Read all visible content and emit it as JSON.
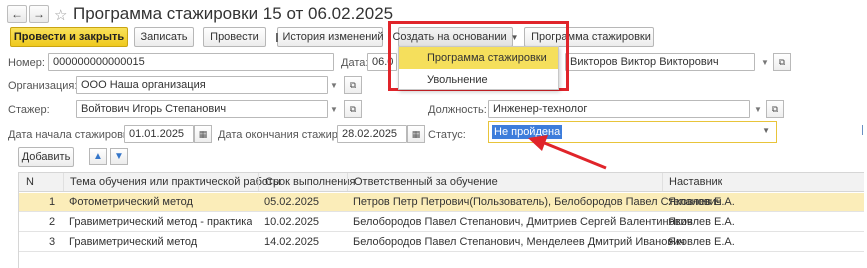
{
  "nav": {
    "back": "←",
    "forward": "→"
  },
  "window": {
    "title": "Программа стажировки 15 от 06.02.2025"
  },
  "toolbar": {
    "post_close": "Провести и закрыть",
    "save": "Записать",
    "post": "Провести",
    "history": "История изменений",
    "create_based": "Создать на основании",
    "print": "Программа стажировки"
  },
  "dropdown_menu": {
    "items": [
      "Программа стажировки",
      "Увольнение"
    ]
  },
  "form": {
    "number_label": "Номер:",
    "number_value": "000000000000015",
    "date_label": "Дата:",
    "date_value": "06.0",
    "mentor_value": "Викторов Виктор Викторович",
    "org_label": "Организация:",
    "org_value": "ООО Наша организация",
    "trainee_label": "Стажер:",
    "trainee_value": "Войтович Игорь Степанович",
    "position_label": "Должность:",
    "position_value": "Инженер-технолог",
    "start_label": "Дата начала стажировки:",
    "start_value": "01.01.2025",
    "end_label": "Дата окончания стажировки:",
    "end_value": "28.02.2025",
    "status_label": "Статус:",
    "status_value": "Не пройдена"
  },
  "table_toolbar": {
    "add": "Добавить"
  },
  "table": {
    "columns": [
      "N",
      "Тема обучения или практической работы",
      "Срок выполнения",
      "Ответственный за обучение",
      "Наставник"
    ],
    "rows": [
      [
        "1",
        "Фотометрический метод",
        "05.02.2025",
        "Петров Петр Петрович(Пользователь), Белобородов Павел Степанович",
        "Яковлев Е.А."
      ],
      [
        "2",
        "Гравиметрический метод - практика",
        "10.02.2025",
        "Белобородов Павел Степанович, Дмитриев Сергей Валентинович",
        "Яковлев Е.А."
      ],
      [
        "3",
        "Гравиметрический метод",
        "14.02.2025",
        "Белобородов Павел Степанович, Менделеев Дмитрий Иванович",
        "Яковлев Е.А."
      ]
    ]
  },
  "colors": {
    "accent_yellow": "#f2d230",
    "highlight_red": "#e0242a",
    "selection": "#fbedb9"
  }
}
